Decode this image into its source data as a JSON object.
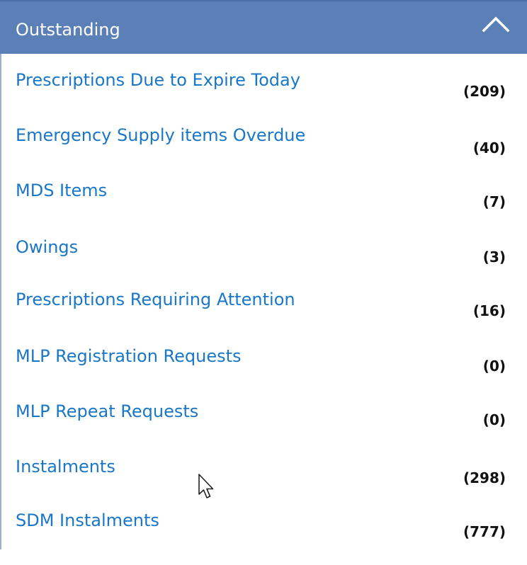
{
  "panel": {
    "title": "Outstanding",
    "collapse_icon": "chevron-up-icon",
    "colors": {
      "header_bg": "#5b80b7",
      "link": "#1a77c8",
      "count": "#111111"
    },
    "items": [
      {
        "label": "Prescriptions Due to Expire Today",
        "count": "(209)"
      },
      {
        "label": "Emergency Supply items Overdue",
        "count": "(40)"
      },
      {
        "label": "MDS Items",
        "count": "(7)"
      },
      {
        "label": "Owings",
        "count": "(3)"
      },
      {
        "label": "Prescriptions Requiring Attention",
        "count": "(16)"
      },
      {
        "label": "MLP Registration Requests",
        "count": "(0)"
      },
      {
        "label": "MLP Repeat Requests",
        "count": "(0)"
      },
      {
        "label": "Instalments",
        "count": "(298)"
      },
      {
        "label": "SDM Instalments",
        "count": "(777)"
      }
    ]
  },
  "cursor_icon": "mouse-pointer-icon"
}
